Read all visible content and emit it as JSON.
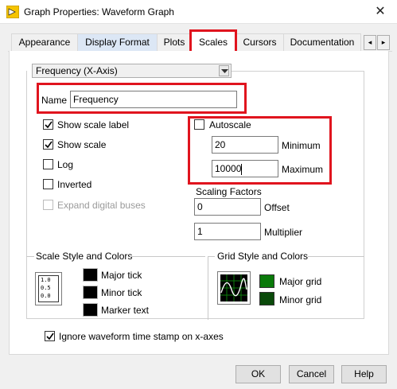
{
  "window": {
    "title": "Graph Properties: Waveform Graph",
    "close_glyph": "✕"
  },
  "tabs": [
    {
      "label": "Appearance"
    },
    {
      "label": "Display Format"
    },
    {
      "label": "Plots"
    },
    {
      "label": "Scales"
    },
    {
      "label": "Cursors"
    },
    {
      "label": "Documentation"
    }
  ],
  "tab_scroll": {
    "left": "◂",
    "right": "▸"
  },
  "scale_select": {
    "value": "Frequency (X-Axis)"
  },
  "name": {
    "label": "Name",
    "value": "Frequency"
  },
  "checkboxes": {
    "show_scale_label": {
      "label": "Show scale label",
      "checked": true
    },
    "show_scale": {
      "label": "Show scale",
      "checked": true
    },
    "log": {
      "label": "Log",
      "checked": false
    },
    "inverted": {
      "label": "Inverted",
      "checked": false
    },
    "expand_digital_buses": {
      "label": "Expand digital buses",
      "checked": false,
      "disabled": true
    },
    "autoscale": {
      "label": "Autoscale",
      "checked": false
    }
  },
  "range": {
    "minimum": {
      "label": "Minimum",
      "value": "20"
    },
    "maximum": {
      "label": "Maximum",
      "value": "10000"
    }
  },
  "scaling": {
    "title": "Scaling Factors",
    "offset": {
      "label": "Offset",
      "value": "0"
    },
    "multiplier": {
      "label": "Multiplier",
      "value": "1"
    }
  },
  "scale_style": {
    "title": "Scale Style and Colors",
    "icon_ticks": [
      "1.0",
      "0.5",
      "0.0"
    ],
    "major_tick": "Major tick",
    "minor_tick": "Minor tick",
    "marker_text": "Marker text"
  },
  "grid_style": {
    "title": "Grid Style and Colors",
    "major_grid": "Major grid",
    "minor_grid": "Minor grid"
  },
  "ignore_timestamp": {
    "label": "Ignore waveform time stamp on x-axes",
    "checked": true
  },
  "buttons": {
    "ok": "OK",
    "cancel": "Cancel",
    "help": "Help"
  },
  "colors": {
    "highlight": "#e0141e",
    "major_grid": "#0a7a0a",
    "minor_grid": "#0a4a0a",
    "swatch_black": "#000000"
  }
}
